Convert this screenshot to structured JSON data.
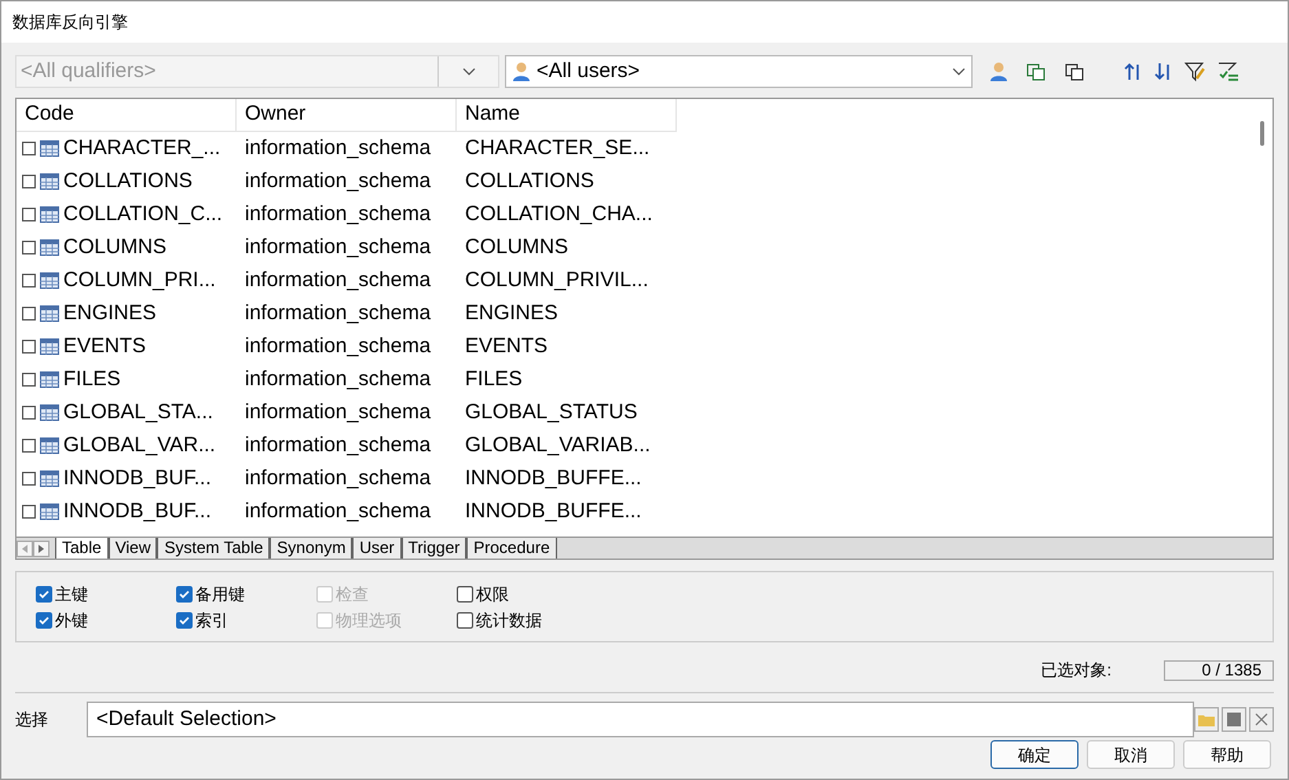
{
  "window": {
    "title": "数据库反向引擎"
  },
  "qualifier_filter": {
    "placeholder": "<All qualifiers>"
  },
  "user_filter": {
    "value": "<All users>"
  },
  "table": {
    "columns": [
      "Code",
      "Owner",
      "Name"
    ],
    "rows": [
      {
        "code": "CHARACTER_...",
        "owner": "information_schema",
        "name": "CHARACTER_SE...",
        "checked": false
      },
      {
        "code": "COLLATIONS",
        "owner": "information_schema",
        "name": "COLLATIONS",
        "checked": false
      },
      {
        "code": "COLLATION_C...",
        "owner": "information_schema",
        "name": "COLLATION_CHA...",
        "checked": false
      },
      {
        "code": "COLUMNS",
        "owner": "information_schema",
        "name": "COLUMNS",
        "checked": false
      },
      {
        "code": "COLUMN_PRI...",
        "owner": "information_schema",
        "name": "COLUMN_PRIVIL...",
        "checked": false
      },
      {
        "code": "ENGINES",
        "owner": "information_schema",
        "name": "ENGINES",
        "checked": false
      },
      {
        "code": "EVENTS",
        "owner": "information_schema",
        "name": "EVENTS",
        "checked": false
      },
      {
        "code": "FILES",
        "owner": "information_schema",
        "name": "FILES",
        "checked": false
      },
      {
        "code": "GLOBAL_STA...",
        "owner": "information_schema",
        "name": "GLOBAL_STATUS",
        "checked": false
      },
      {
        "code": "GLOBAL_VAR...",
        "owner": "information_schema",
        "name": "GLOBAL_VARIAB...",
        "checked": false
      },
      {
        "code": "INNODB_BUF...",
        "owner": "information_schema",
        "name": "INNODB_BUFFE...",
        "checked": false
      },
      {
        "code": "INNODB_BUF...",
        "owner": "information_schema",
        "name": "INNODB_BUFFE...",
        "checked": false
      }
    ]
  },
  "tabs": [
    {
      "label": "Table",
      "selected": true
    },
    {
      "label": "View",
      "selected": false
    },
    {
      "label": "System Table",
      "selected": false
    },
    {
      "label": "Synonym",
      "selected": false
    },
    {
      "label": "User",
      "selected": false
    },
    {
      "label": "Trigger",
      "selected": false
    },
    {
      "label": "Procedure",
      "selected": false
    }
  ],
  "options": [
    {
      "label": "主键",
      "checked": true,
      "disabled": false
    },
    {
      "label": "外键",
      "checked": true,
      "disabled": false
    },
    {
      "label": "备用键",
      "checked": true,
      "disabled": false
    },
    {
      "label": "索引",
      "checked": true,
      "disabled": false
    },
    {
      "label": "检查",
      "checked": false,
      "disabled": true
    },
    {
      "label": "物理选项",
      "checked": false,
      "disabled": true
    },
    {
      "label": "权限",
      "checked": false,
      "disabled": false
    },
    {
      "label": "统计数据",
      "checked": false,
      "disabled": false
    }
  ],
  "selected_objects": {
    "label": "已选对象:",
    "value": "0 / 1385"
  },
  "selection": {
    "label": "选择",
    "value": "<Default Selection>"
  },
  "buttons": [
    {
      "label": "确定",
      "default": true
    },
    {
      "label": "取消",
      "default": false
    },
    {
      "label": "帮助",
      "default": false
    }
  ]
}
